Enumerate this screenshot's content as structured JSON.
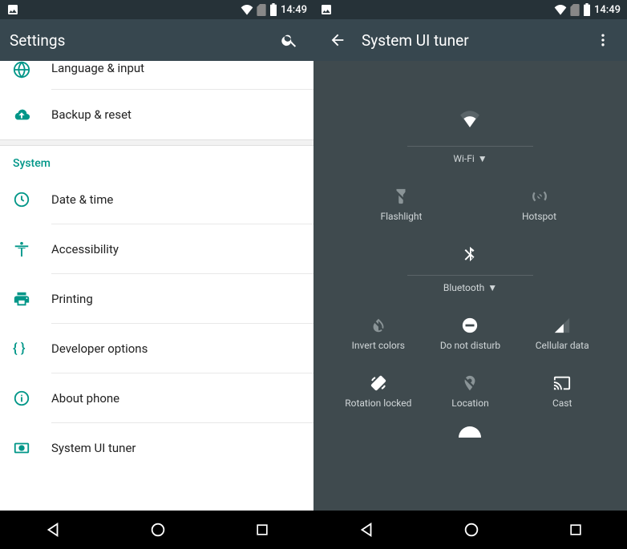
{
  "left": {
    "status": {
      "time": "14:49"
    },
    "appbar": {
      "title": "Settings"
    },
    "rows": {
      "r0": "Language & input",
      "r1": "Backup & reset",
      "section": "System",
      "r2": "Date & time",
      "r3": "Accessibility",
      "r4": "Printing",
      "r5": "Developer options",
      "r6": "About phone",
      "r7": "System UI tuner"
    }
  },
  "right": {
    "status": {
      "time": "14:49"
    },
    "appbar": {
      "title": "System UI tuner"
    },
    "tiles": {
      "wifi": "Wi-Fi",
      "flashlight": "Flashlight",
      "hotspot": "Hotspot",
      "bluetooth": "Bluetooth",
      "invert": "Invert colors",
      "dnd": "Do not disturb",
      "cellular": "Cellular data",
      "rotation": "Rotation locked",
      "location": "Location",
      "cast": "Cast"
    }
  }
}
